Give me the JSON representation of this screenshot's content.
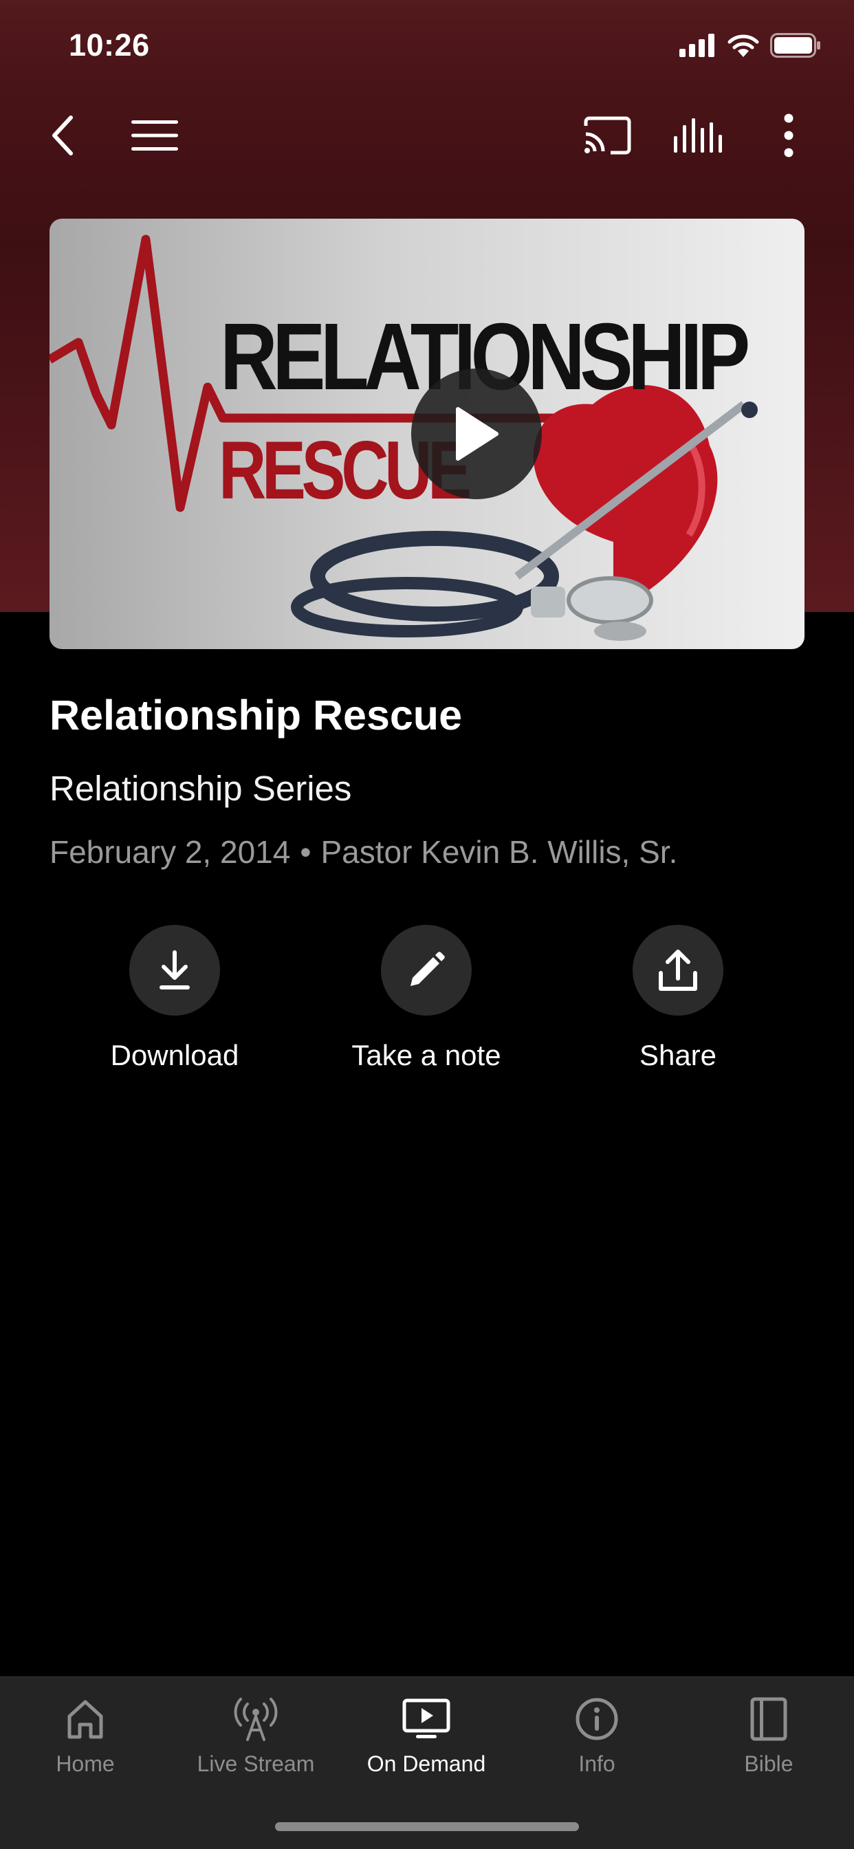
{
  "status_bar": {
    "time": "10:26"
  },
  "toolbar": {
    "back_icon": "chevron-left-icon",
    "menu_icon": "hamburger-icon",
    "cast_icon": "cast-icon",
    "audio_icon": "equalizer-icon",
    "more_icon": "more-vertical-icon"
  },
  "media": {
    "thumbnail_text_1": "RELATIONSHIP",
    "thumbnail_text_2": "RESCUE",
    "title": "Relationship Rescue",
    "series": "Relationship Series",
    "date": "February 2, 2014",
    "separator": "•",
    "speaker": "Pastor Kevin B. Willis, Sr."
  },
  "actions": [
    {
      "label": "Download",
      "icon": "download-icon"
    },
    {
      "label": "Take a note",
      "icon": "pencil-icon"
    },
    {
      "label": "Share",
      "icon": "share-icon"
    }
  ],
  "tabs": [
    {
      "label": "Home",
      "icon": "home-icon",
      "active": false
    },
    {
      "label": "Live Stream",
      "icon": "broadcast-icon",
      "active": false
    },
    {
      "label": "On Demand",
      "icon": "tv-play-icon",
      "active": true
    },
    {
      "label": "Info",
      "icon": "info-icon",
      "active": false
    },
    {
      "label": "Bible",
      "icon": "book-icon",
      "active": false
    }
  ],
  "colors": {
    "header_bg": "#4a1418",
    "accent_red": "#a3141c",
    "tab_active": "#ffffff",
    "tab_inactive": "#8e8e8e"
  }
}
